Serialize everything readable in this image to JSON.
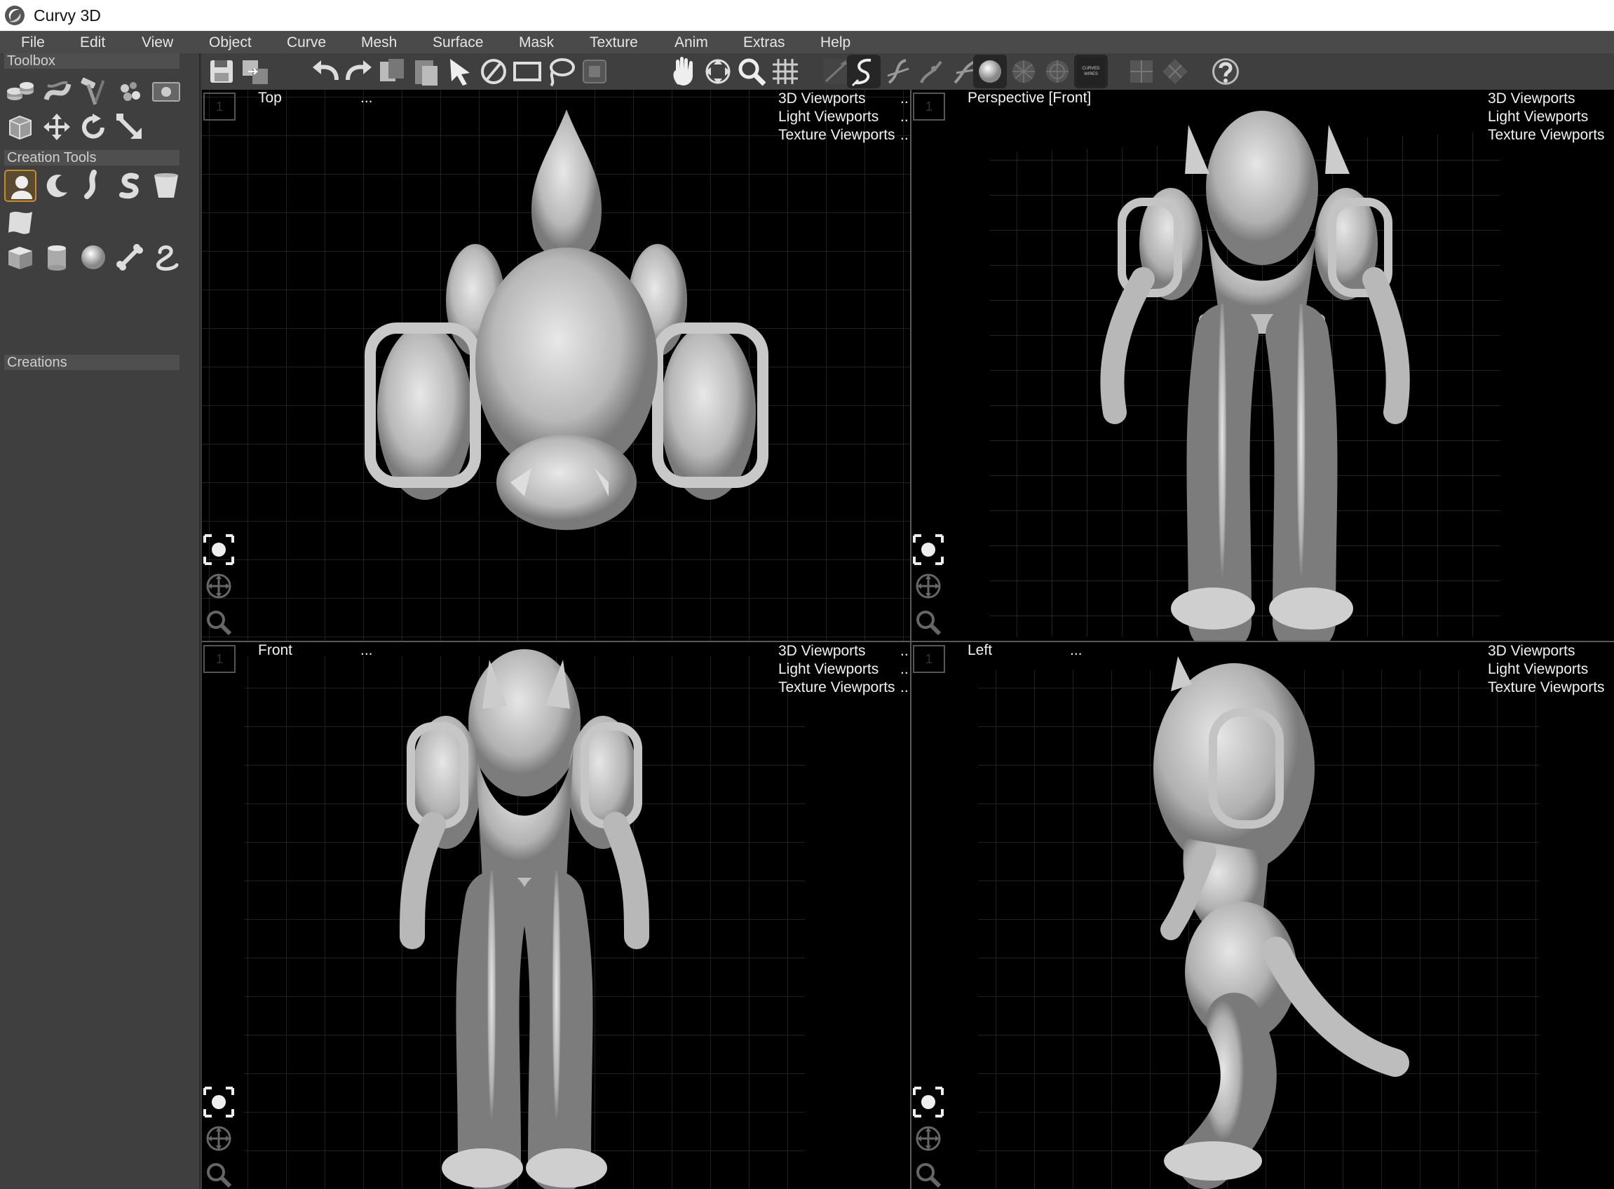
{
  "window": {
    "title": "Curvy 3D"
  },
  "menu": [
    "File",
    "Edit",
    "View",
    "Object",
    "Curve",
    "Mesh",
    "Surface",
    "Mask",
    "Texture",
    "Anim",
    "Extras",
    "Help"
  ],
  "panels": {
    "toolbox": "Toolbox",
    "creation_tools": "Creation Tools",
    "creations": "Creations"
  },
  "toolbar": {
    "curved_wires_badge": "CURVED WIRES"
  },
  "viewports": [
    {
      "name": "Top",
      "dots": "...",
      "menu": [
        "3D Viewports",
        "Light Viewports",
        "Texture Viewports"
      ],
      "num": "1"
    },
    {
      "name": "Perspective [Front]",
      "dots": "",
      "menu": [
        "3D Viewports",
        "Light Viewports",
        "Texture Viewports"
      ],
      "num": "1"
    },
    {
      "name": "Front",
      "dots": "...",
      "menu": [
        "3D Viewports",
        "Light Viewports",
        "Texture Viewports"
      ],
      "num": "1"
    },
    {
      "name": "Left",
      "dots": "...",
      "menu": [
        "3D Viewports",
        "Light Viewports",
        "Texture Viewports"
      ],
      "num": "1"
    }
  ],
  "menu_ellipsis": ".."
}
